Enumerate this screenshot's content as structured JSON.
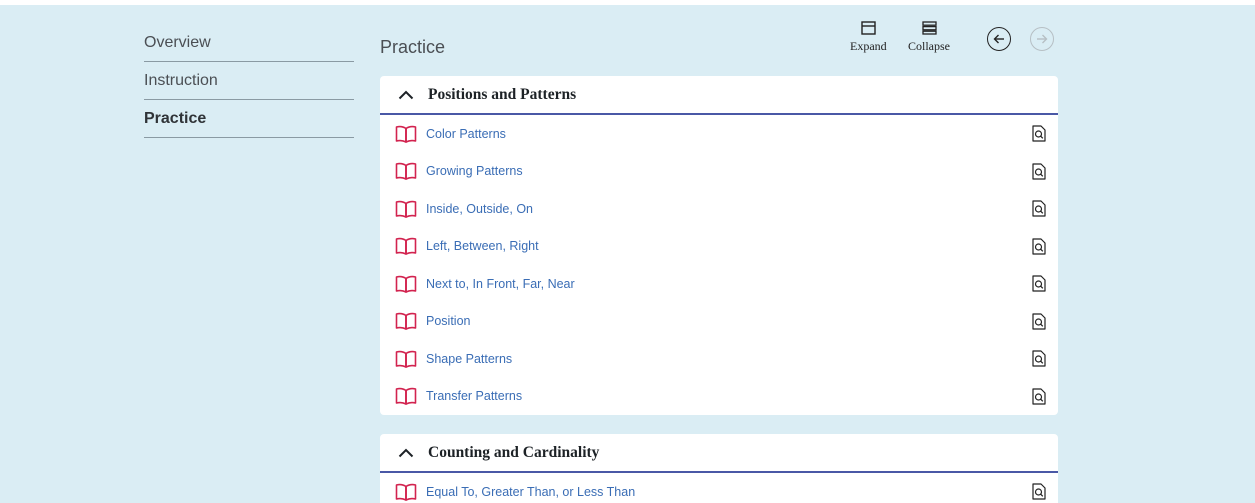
{
  "colors": {
    "background": "#daedf4",
    "link": "#3a6db5",
    "book_icon": "#d2234f",
    "header_rule": "#4a58a6"
  },
  "sidebar": {
    "items": [
      {
        "label": "Overview",
        "active": false
      },
      {
        "label": "Instruction",
        "active": false
      },
      {
        "label": "Practice",
        "active": true
      }
    ]
  },
  "header": {
    "title": "Practice",
    "expand_label": "Expand",
    "collapse_label": "Collapse",
    "back_icon": "arrow-left-circle-icon",
    "forward_icon": "arrow-right-circle-icon"
  },
  "sections": [
    {
      "title": "Positions and Patterns",
      "items": [
        "Color Patterns",
        "Growing Patterns",
        "Inside, Outside, On",
        "Left, Between, Right",
        "Next to, In Front, Far, Near",
        "Position",
        "Shape Patterns",
        "Transfer Patterns"
      ]
    },
    {
      "title": "Counting and Cardinality",
      "items": [
        "Equal To, Greater Than, or Less Than"
      ]
    }
  ]
}
